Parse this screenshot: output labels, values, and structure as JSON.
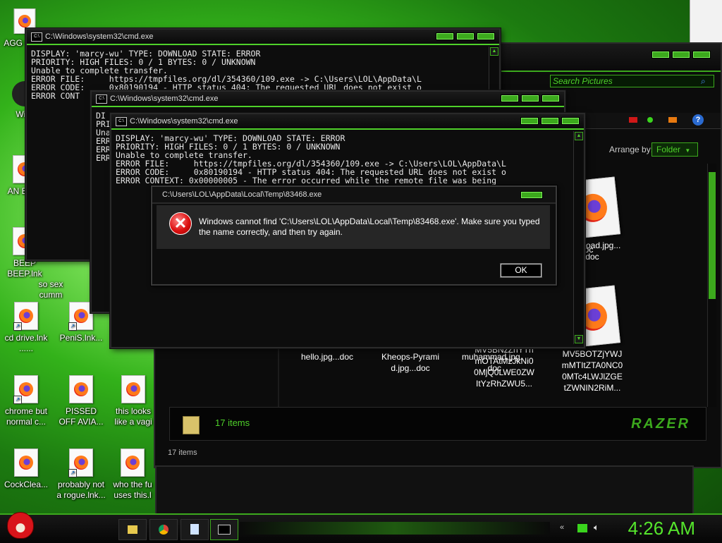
{
  "desktop_icons": [
    {
      "label": "AGG CHIC",
      "kind": "text"
    },
    {
      "label": "Wi V",
      "kind": "text"
    },
    {
      "label": "AN BIRD",
      "kind": "text"
    },
    {
      "label": "BEEP BEEP.lnk",
      "kind": "text"
    },
    {
      "label": "so sex cumm",
      "kind": "text"
    },
    {
      "label": "cd drive.lnk ......",
      "kind": "doc"
    },
    {
      "label": "PeniS.lnk...",
      "kind": "doc"
    },
    {
      "label": "chrome but normal c...",
      "kind": "doc"
    },
    {
      "label": "PISSED OFF AVIA...",
      "kind": "doc"
    },
    {
      "label": "this looks like a vagi",
      "kind": "doc"
    },
    {
      "label": "CockClea...",
      "kind": "doc"
    },
    {
      "label": "probably not a rogue.lnk...",
      "kind": "doc"
    },
    {
      "label": "who the fu uses this.l",
      "kind": "doc"
    }
  ],
  "cmd1": {
    "title": "C:\\Windows\\system32\\cmd.exe",
    "lines": [
      "DISPLAY: 'marcy-wu' TYPE: DOWNLOAD STATE: ERROR",
      "PRIORITY: HIGH FILES: 0 / 1 BYTES: 0 / UNKNOWN",
      "Unable to complete transfer.",
      "ERROR FILE:     https://tmpfiles.org/dl/354360/109.exe -> C:\\Users\\LOL\\AppData\\L",
      "ERROR CODE:     0x80190194 - HTTP status 404: The requested URL does not exist o",
      "ERROR CONT"
    ]
  },
  "cmd2": {
    "title": "C:\\Windows\\system32\\cmd.exe",
    "lines": [
      "DI",
      "PRI",
      "Una",
      "ERR",
      "ERR",
      "ERR"
    ]
  },
  "cmd3": {
    "title": "C:\\Windows\\system32\\cmd.exe",
    "lines": [
      "DISPLAY: 'marcy-wu' TYPE: DOWNLOAD STATE: ERROR",
      "PRIORITY: HIGH FILES: 0 / 1 BYTES: 0 / UNKNOWN",
      "Unable to complete transfer.",
      "ERROR FILE:     https://tmpfiles.org/dl/354360/109.exe -> C:\\Users\\LOL\\AppData\\L",
      "ERROR CODE:     0x80190194 - HTTP status 404: The requested URL does not exist o",
      "ERROR CONTEXT: 0x00000005 - The error occurred while the remote file was being"
    ]
  },
  "explorer": {
    "search_placeholder": "Search Pictures",
    "arrange_label": "Arrange by:",
    "arrange_value": "Folder",
    "files": [
      {
        "label": ".doc"
      },
      {
        "label": "download.jpg...\ndoc"
      },
      {
        "label": "hello.jpg...doc"
      },
      {
        "label": "Kheops-Pyrami\nd.jpg...doc"
      },
      {
        "label": "muhammad.jpg.\n..doc"
      },
      {
        "label": "MV5BNzZhYTh\nmOTAtMzJkNi0\n0MjQ0LWE0ZW\nItYzRhZWU5..."
      },
      {
        "label": "MV5BOTZjYWJ\nmMTItZTA0NC0\n0MTc4LWJlZGE\ntZWNIN2RiM..."
      }
    ],
    "item_count": "17 items",
    "status_count": "17 items",
    "brand": "RAZER"
  },
  "dialog": {
    "title": "C:\\Users\\LOL\\AppData\\Local\\Temp\\83468.exe",
    "message": "Windows cannot find 'C:\\Users\\LOL\\AppData\\Local\\Temp\\83468.exe'. Make sure you typed the name correctly, and then try again.",
    "ok_label": "OK"
  },
  "taskbar": {
    "clock": "4:26 AM"
  },
  "colors": {
    "accent": "#4fd12a",
    "window_bg": "#0d0d0d"
  }
}
